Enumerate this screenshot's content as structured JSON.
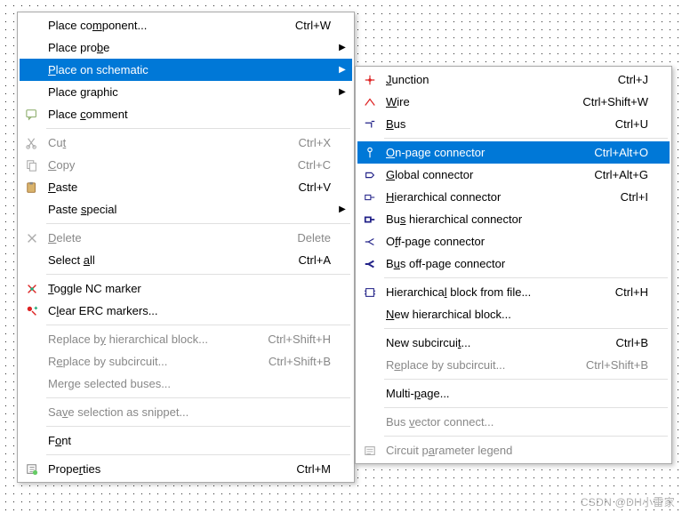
{
  "watermark": "CSDN @DH小雷家",
  "main_menu": {
    "groups": [
      [
        {
          "icon": "",
          "pre": "Place co",
          "mn": "m",
          "post": "ponent...",
          "shortcut": "Ctrl+W",
          "arrow": false,
          "hl": false,
          "dis": false,
          "name": "place-component"
        },
        {
          "icon": "",
          "pre": "Place pro",
          "mn": "b",
          "post": "e",
          "shortcut": "",
          "arrow": true,
          "hl": false,
          "dis": false,
          "name": "place-probe"
        },
        {
          "icon": "",
          "pre": "",
          "mn": "P",
          "post": "lace on schematic",
          "shortcut": "",
          "arrow": true,
          "hl": true,
          "dis": false,
          "name": "place-on-schematic"
        },
        {
          "icon": "",
          "pre": "Place ",
          "mn": "g",
          "post": "raphic",
          "shortcut": "",
          "arrow": true,
          "hl": false,
          "dis": false,
          "name": "place-graphic"
        },
        {
          "icon": "comment",
          "pre": "Place ",
          "mn": "c",
          "post": "omment",
          "shortcut": "",
          "arrow": false,
          "hl": false,
          "dis": false,
          "name": "place-comment"
        }
      ],
      [
        {
          "icon": "cut",
          "pre": "Cu",
          "mn": "t",
          "post": "",
          "shortcut": "Ctrl+X",
          "arrow": false,
          "hl": false,
          "dis": true,
          "name": "cut"
        },
        {
          "icon": "copy",
          "pre": "",
          "mn": "C",
          "post": "opy",
          "shortcut": "Ctrl+C",
          "arrow": false,
          "hl": false,
          "dis": true,
          "name": "copy"
        },
        {
          "icon": "paste",
          "pre": "",
          "mn": "P",
          "post": "aste",
          "shortcut": "Ctrl+V",
          "arrow": false,
          "hl": false,
          "dis": false,
          "name": "paste"
        },
        {
          "icon": "",
          "pre": "Paste ",
          "mn": "s",
          "post": "pecial",
          "shortcut": "",
          "arrow": true,
          "hl": false,
          "dis": false,
          "name": "paste-special"
        }
      ],
      [
        {
          "icon": "delete",
          "pre": "",
          "mn": "D",
          "post": "elete",
          "shortcut": "Delete",
          "arrow": false,
          "hl": false,
          "dis": true,
          "name": "delete"
        },
        {
          "icon": "",
          "pre": "Select ",
          "mn": "a",
          "post": "ll",
          "shortcut": "Ctrl+A",
          "arrow": false,
          "hl": false,
          "dis": false,
          "name": "select-all"
        }
      ],
      [
        {
          "icon": "nc",
          "pre": "",
          "mn": "T",
          "post": "oggle NC marker",
          "shortcut": "",
          "arrow": false,
          "hl": false,
          "dis": false,
          "name": "toggle-nc-marker"
        },
        {
          "icon": "erc",
          "pre": "C",
          "mn": "l",
          "post": "ear ERC markers...",
          "shortcut": "",
          "arrow": false,
          "hl": false,
          "dis": false,
          "name": "clear-erc-markers"
        }
      ],
      [
        {
          "icon": "",
          "pre": "Replace b",
          "mn": "y",
          "post": " hierarchical block...",
          "shortcut": "Ctrl+Shift+H",
          "arrow": false,
          "hl": false,
          "dis": true,
          "name": "replace-hier-block"
        },
        {
          "icon": "",
          "pre": "R",
          "mn": "e",
          "post": "place by subcircuit...",
          "shortcut": "Ctrl+Shift+B",
          "arrow": false,
          "hl": false,
          "dis": true,
          "name": "replace-subcircuit"
        },
        {
          "icon": "",
          "pre": "Mer",
          "mn": "g",
          "post": "e selected buses...",
          "shortcut": "",
          "arrow": false,
          "hl": false,
          "dis": true,
          "name": "merge-buses"
        }
      ],
      [
        {
          "icon": "",
          "pre": "Sa",
          "mn": "v",
          "post": "e selection as snippet...",
          "shortcut": "",
          "arrow": false,
          "hl": false,
          "dis": true,
          "name": "save-snippet"
        }
      ],
      [
        {
          "icon": "",
          "pre": "F",
          "mn": "o",
          "post": "nt",
          "shortcut": "",
          "arrow": false,
          "hl": false,
          "dis": false,
          "name": "font"
        }
      ],
      [
        {
          "icon": "props",
          "pre": "Prope",
          "mn": "r",
          "post": "ties",
          "shortcut": "Ctrl+M",
          "arrow": false,
          "hl": false,
          "dis": false,
          "name": "properties"
        }
      ]
    ]
  },
  "sub_menu": {
    "groups": [
      [
        {
          "icon": "junction",
          "pre": "",
          "mn": "J",
          "post": "unction",
          "shortcut": "Ctrl+J",
          "arrow": false,
          "hl": false,
          "dis": false,
          "name": "junction"
        },
        {
          "icon": "wire",
          "pre": "",
          "mn": "W",
          "post": "ire",
          "shortcut": "Ctrl+Shift+W",
          "arrow": false,
          "hl": false,
          "dis": false,
          "name": "wire"
        },
        {
          "icon": "bus",
          "pre": "",
          "mn": "B",
          "post": "us",
          "shortcut": "Ctrl+U",
          "arrow": false,
          "hl": false,
          "dis": false,
          "name": "bus"
        }
      ],
      [
        {
          "icon": "onpage",
          "pre": "",
          "mn": "O",
          "post": "n-page connector",
          "shortcut": "Ctrl+Alt+O",
          "arrow": false,
          "hl": true,
          "dis": false,
          "name": "on-page-connector"
        },
        {
          "icon": "global",
          "pre": "",
          "mn": "G",
          "post": "lobal connector",
          "shortcut": "Ctrl+Alt+G",
          "arrow": false,
          "hl": false,
          "dis": false,
          "name": "global-connector"
        },
        {
          "icon": "hier",
          "pre": "",
          "mn": "H",
          "post": "ierarchical connector",
          "shortcut": "Ctrl+I",
          "arrow": false,
          "hl": false,
          "dis": false,
          "name": "hierarchical-connector"
        },
        {
          "icon": "bushier",
          "pre": "Bu",
          "mn": "s",
          "post": " hierarchical connector",
          "shortcut": "",
          "arrow": false,
          "hl": false,
          "dis": false,
          "name": "bus-hier-connector"
        },
        {
          "icon": "offpage",
          "pre": "O",
          "mn": "f",
          "post": "f-page connector",
          "shortcut": "",
          "arrow": false,
          "hl": false,
          "dis": false,
          "name": "off-page-connector"
        },
        {
          "icon": "busoff",
          "pre": "B",
          "mn": "u",
          "post": "s off-page connector",
          "shortcut": "",
          "arrow": false,
          "hl": false,
          "dis": false,
          "name": "bus-off-page-connector"
        }
      ],
      [
        {
          "icon": "hblock",
          "pre": "Hierarchica",
          "mn": "l",
          "post": " block from file...",
          "shortcut": "Ctrl+H",
          "arrow": false,
          "hl": false,
          "dis": false,
          "name": "hier-block-from-file"
        },
        {
          "icon": "",
          "pre": "",
          "mn": "N",
          "post": "ew hierarchical block...",
          "shortcut": "",
          "arrow": false,
          "hl": false,
          "dis": false,
          "name": "new-hier-block"
        }
      ],
      [
        {
          "icon": "",
          "pre": "New subcircui",
          "mn": "t",
          "post": "...",
          "shortcut": "Ctrl+B",
          "arrow": false,
          "hl": false,
          "dis": false,
          "name": "new-subcircuit"
        },
        {
          "icon": "",
          "pre": "R",
          "mn": "e",
          "post": "place by subcircuit...",
          "shortcut": "Ctrl+Shift+B",
          "arrow": false,
          "hl": false,
          "dis": true,
          "name": "replace-subcircuit-sub"
        }
      ],
      [
        {
          "icon": "",
          "pre": "Multi-",
          "mn": "p",
          "post": "age...",
          "shortcut": "",
          "arrow": false,
          "hl": false,
          "dis": false,
          "name": "multi-page"
        }
      ],
      [
        {
          "icon": "",
          "pre": "Bus ",
          "mn": "v",
          "post": "ector connect...",
          "shortcut": "",
          "arrow": false,
          "hl": false,
          "dis": true,
          "name": "bus-vector-connect"
        }
      ],
      [
        {
          "icon": "legend",
          "pre": "Circuit p",
          "mn": "a",
          "post": "rameter legend",
          "shortcut": "",
          "arrow": false,
          "hl": false,
          "dis": true,
          "name": "circuit-param-legend"
        }
      ]
    ]
  },
  "icons": {
    "comment": {
      "svg": "<svg width='14' height='14' viewBox='0 0 16 16'><rect x='1' y='2' width='12' height='9' rx='1' fill='none' stroke='#8a6' stroke-width='1.2'/><path d='M4 11 L4 14 L7 11' fill='none' stroke='#8a6' stroke-width='1.2'/></svg>"
    },
    "cut": {
      "svg": "<svg width='14' height='14' viewBox='0 0 16 16'><path d='M3 2 L11 13 M11 2 L3 13' stroke='#aaa' stroke-width='1.3'/><circle cx='3' cy='13' r='2' fill='none' stroke='#aaa' stroke-width='1.2'/><circle cx='11' cy='13' r='2' fill='none' stroke='#aaa' stroke-width='1.2'/></svg>"
    },
    "copy": {
      "svg": "<svg width='14' height='14' viewBox='0 0 16 16'><rect x='2' y='2' width='8' height='10' fill='none' stroke='#aaa' stroke-width='1.2'/><rect x='5' y='5' width='8' height='10' fill='#fff' stroke='#aaa' stroke-width='1.2'/></svg>"
    },
    "paste": {
      "svg": "<svg width='14' height='14' viewBox='0 0 16 16'><rect x='2' y='2' width='10' height='12' rx='1' fill='#d9b36c' stroke='#a07030' stroke-width='1'/><rect x='5' y='1' width='4' height='3' fill='#888'/></svg>"
    },
    "delete": {
      "svg": "<svg width='14' height='14' viewBox='0 0 16 16'><path d='M3 3 L13 13 M13 3 L3 13' stroke='#aaa' stroke-width='1.6'/></svg>"
    },
    "nc": {
      "svg": "<svg width='14' height='14' viewBox='0 0 16 16'><path d='M3 3 L13 13 M13 3 L3 13' stroke='#d22' stroke-width='1.6'/><circle cx='8' cy='8' r='2' fill='#2a7'/></svg>"
    },
    "erc": {
      "svg": "<svg width='14' height='14' viewBox='0 0 16 16'><circle cx='5' cy='5' r='3' fill='#d22'/><path d='M8 8 L13 13' stroke='#d22' stroke-width='1.6'/><path d='M11 4 L15 4 M13 2 L13 6' stroke='#2a7' stroke-width='1.4'/></svg>"
    },
    "props": {
      "svg": "<svg width='14' height='14' viewBox='0 0 16 16'><rect x='2' y='2' width='11' height='11' fill='none' stroke='#888' stroke-width='1.2'/><path d='M5 5h6M5 8h6M5 11h4' stroke='#888' stroke-width='1'/><circle cx='12' cy='12' r='3' fill='#6c6'/></svg>"
    },
    "junction": {
      "svg": "<svg width='14' height='14' viewBox='0 0 16 16'><path d='M8 2 V14 M2 8 H14' stroke='#d22' stroke-width='1.3'/><circle cx='8' cy='8' r='2' fill='#d22'/></svg>"
    },
    "wire": {
      "svg": "<svg width='14' height='14' viewBox='0 0 16 16'><path d='M2 12 L8 4 L14 12' fill='none' stroke='#d22' stroke-width='1.4'/></svg>"
    },
    "bus": {
      "svg": "<svg width='14' height='14' viewBox='0 0 16 16'><path d='M2 6 H10 V12' fill='none' stroke='#228' stroke-width='1.4'/><path d='M10 4 H14' stroke='#228' stroke-width='1.4'/></svg>"
    },
    "onpage": {
      "svg": "<svg width='14' height='14' viewBox='0 0 16 16'><circle cx='8' cy='4' r='2.5' fill='none' stroke='#fff' stroke-width='1.3'/><path d='M8 6 V14' stroke='#fff' stroke-width='1.3'/></svg>"
    },
    "onpage_normal": {
      "svg": "<svg width='14' height='14' viewBox='0 0 16 16'><circle cx='8' cy='4' r='2.5' fill='none' stroke='#228' stroke-width='1.3'/><path d='M8 6 V14' stroke='#228' stroke-width='1.3'/></svg>"
    },
    "global": {
      "svg": "<svg width='14' height='14' viewBox='0 0 16 16'><path d='M3 5 H10 L13 8 L10 11 H3 Z' fill='none' stroke='#228' stroke-width='1.3'/></svg>"
    },
    "hier": {
      "svg": "<svg width='14' height='14' viewBox='0 0 16 16'><rect x='2' y='5' width='7' height='6' fill='none' stroke='#228' stroke-width='1.2'/><path d='M9 8 H14' stroke='#228' stroke-width='1.2'/></svg>"
    },
    "bushier": {
      "svg": "<svg width='14' height='14' viewBox='0 0 16 16'><rect x='2' y='5' width='7' height='6' fill='none' stroke='#228' stroke-width='2'/><path d='M9 8 H14' stroke='#228' stroke-width='2'/></svg>"
    },
    "offpage": {
      "svg": "<svg width='14' height='14' viewBox='0 0 16 16'><path d='M13 4 L6 8 L13 12 M6 8 H2' fill='none' stroke='#228' stroke-width='1.3'/></svg>"
    },
    "busoff": {
      "svg": "<svg width='14' height='14' viewBox='0 0 16 16'><path d='M13 4 L6 8 L13 12 M6 8 H2' fill='none' stroke='#228' stroke-width='2.2'/></svg>"
    },
    "hblock": {
      "svg": "<svg width='14' height='14' viewBox='0 0 16 16'><rect x='3' y='3' width='10' height='10' fill='none' stroke='#228' stroke-width='1.2'/><path d='M3 6 H1 M3 10 H1 M13 6 H15 M13 10 H15' stroke='#228' stroke-width='1.2'/></svg>"
    },
    "legend": {
      "svg": "<svg width='14' height='14' viewBox='0 0 16 16'><rect x='2' y='3' width='12' height='10' fill='none' stroke='#aaa' stroke-width='1.2'/><path d='M4 6h8M4 9h8M4 12h5' stroke='#aaa' stroke-width='1'/></svg>"
    }
  }
}
